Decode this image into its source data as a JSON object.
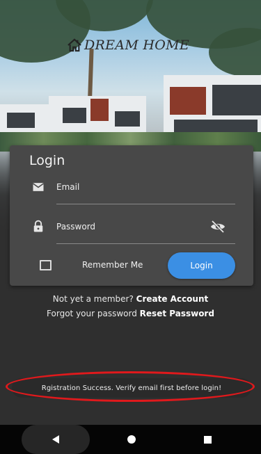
{
  "brand": {
    "name": "DREAM HOME",
    "icon": "house-icon"
  },
  "login_card": {
    "title": "Login",
    "email": {
      "label": "Email",
      "icon": "mail-icon"
    },
    "password": {
      "label": "Password",
      "icon": "lock-icon",
      "toggle_icon": "visibility-off-icon"
    },
    "remember_label": "Remember Me",
    "remember_checked": false,
    "login_button": "Login"
  },
  "links": {
    "member_prompt": "Not yet a member?",
    "create_account": "Create Account",
    "forgot_prompt": "Forgot your password",
    "reset_password": "Reset Password"
  },
  "toast": {
    "message": "Rgistration Success. Verify email first before login!",
    "highlight_color": "#e0191c"
  },
  "navbar": {
    "back_icon": "back-triangle-icon",
    "home_icon": "home-circle-icon",
    "recents_icon": "recents-square-icon"
  },
  "colors": {
    "accent": "#3b8fe4",
    "card": "#484848",
    "background": "#2f2f2f"
  }
}
